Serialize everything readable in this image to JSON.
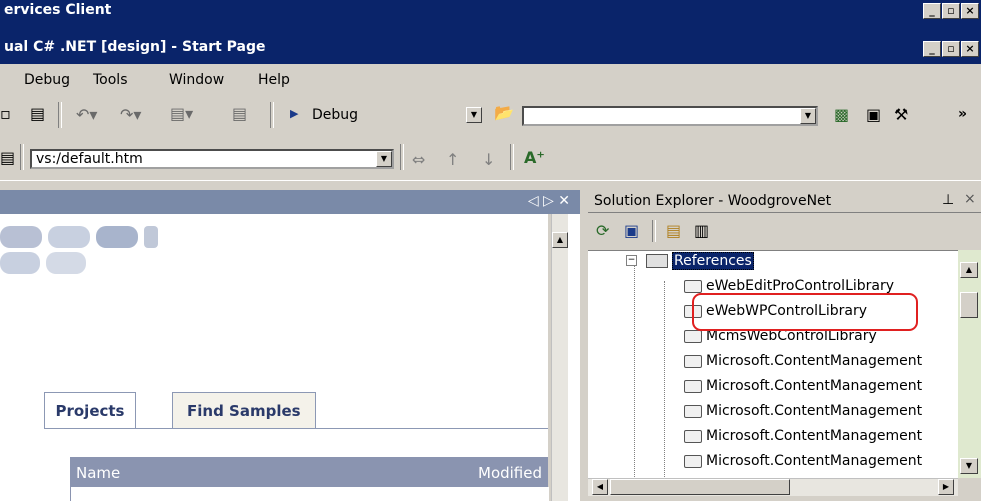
{
  "windows": {
    "outer_title": "ervices Client",
    "inner_title": "ual C# .NET [design] - Start Page"
  },
  "menu": [
    "Debug",
    "Tools",
    "Window",
    "Help"
  ],
  "toolbar": {
    "config": "Debug",
    "find_value": "",
    "overflow": "»"
  },
  "url_bar": {
    "value": "vs:/default.htm"
  },
  "start_page": {
    "tabs": [
      "Projects",
      "Find Samples"
    ],
    "table_headers": [
      "Name",
      "Modified"
    ]
  },
  "solution_explorer": {
    "title": "Solution Explorer - WoodgroveNet",
    "references_label": "References",
    "items": [
      "eWebEditProControlLibrary",
      "eWebWPControlLibrary",
      "McmsWebControlLibrary",
      "Microsoft.ContentManagement",
      "Microsoft.ContentManagement",
      "Microsoft.ContentManagement",
      "Microsoft.ContentManagement",
      "Microsoft.ContentManagement"
    ],
    "highlight_color": "#e02020"
  }
}
